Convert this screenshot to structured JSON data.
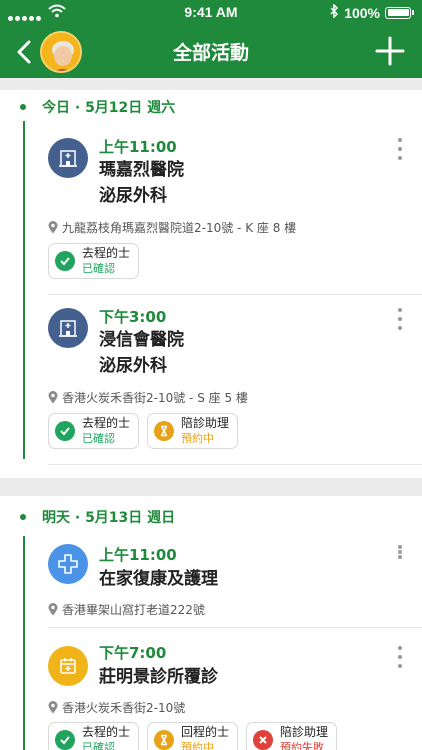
{
  "status_bar": {
    "time": "9:41 AM",
    "battery": "100%"
  },
  "header": {
    "title": "全部活動"
  },
  "colors": {
    "brand": "#1f8a3c",
    "confirmed": "#20a45e",
    "pending": "#e8a21a",
    "cancelled": "#e0413a",
    "hospital": "#44608f",
    "recovery": "#4a93e6",
    "clinic": "#f0b418"
  },
  "sections": [
    {
      "date_label": "今日 · 5月12日 週六",
      "events": [
        {
          "icon": "hospital-icon",
          "time": "上午11:00",
          "name_line1": "瑪嘉烈醫院",
          "name_line2": "泌尿外科",
          "address": "九龍荔枝角瑪嘉烈醫院道2-10號 - K 座 8 樓",
          "chips": [
            {
              "icon": "check-icon",
              "title": "去程的士",
              "status": "已確認"
            }
          ]
        },
        {
          "icon": "hospital-icon",
          "time": "下午3:00",
          "name_line1": "浸信會醫院",
          "name_line2": "泌尿外科",
          "address": "香港火炭禾香街2-10號 - S 座 5 樓",
          "chips": [
            {
              "icon": "check-icon",
              "title": "去程的士",
              "status": "已確認"
            },
            {
              "icon": "hourglass-icon",
              "title": "陪診助理",
              "status": "預約中"
            }
          ]
        }
      ]
    },
    {
      "date_label": "明天 · 5月13日 週日",
      "events": [
        {
          "icon": "medical-cross-icon",
          "time": "上午11:00",
          "name_line1": "在家復康及護理",
          "address": "香港畢架山窩打老道222號",
          "chips": []
        },
        {
          "icon": "calendar-plus-icon",
          "time": "下午7:00",
          "name_line1": "莊明景診所覆診",
          "address": "香港火炭禾香街2-10號",
          "chips": [
            {
              "icon": "check-icon",
              "title": "去程的士",
              "status": "已確認"
            },
            {
              "icon": "hourglass-icon",
              "title": "回程的士",
              "status": "預約中"
            },
            {
              "icon": "cross-icon",
              "title": "陪診助理",
              "status": "預約失敗"
            }
          ]
        }
      ]
    }
  ]
}
